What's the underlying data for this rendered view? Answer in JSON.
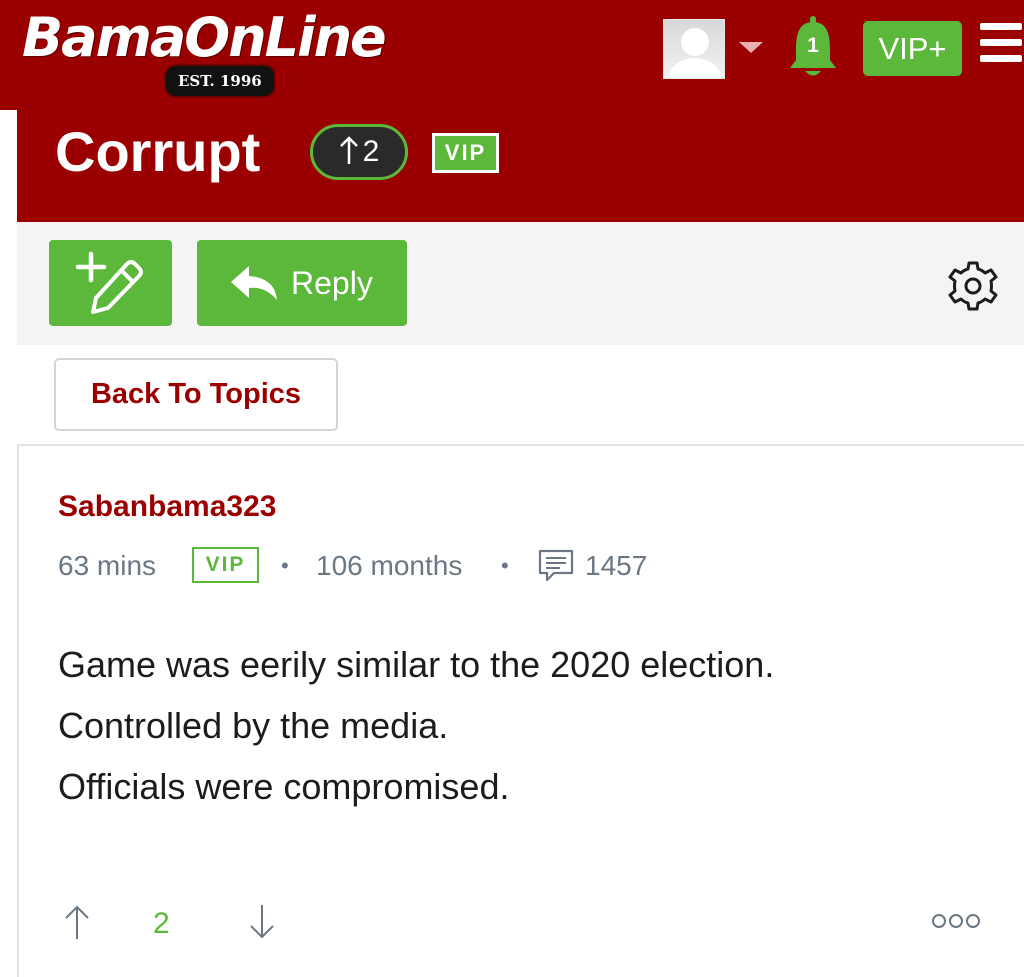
{
  "header": {
    "logo_text": "BamaOnLine",
    "logo_est": "EST. 1996",
    "notification_count": "1",
    "vip_plus_label": "VIP+"
  },
  "thread": {
    "title": "Corrupt",
    "vote_count": "2",
    "vip_badge": "VIP"
  },
  "toolbar": {
    "reply_label": "Reply"
  },
  "nav": {
    "back_label": "Back To Topics"
  },
  "post": {
    "author": "Sabanbama323",
    "time": "63 mins",
    "vip_badge": "VIP",
    "separator": "•",
    "member_for": "106 months",
    "post_count": "1457",
    "body": [
      "Game was eerily similar to the 2020 election.",
      "Controlled by the media.",
      "Officials were compromised."
    ],
    "votes": "2"
  },
  "icons": {
    "notification": "bell-icon",
    "menu": "hamburger-icon",
    "new_post": "compose-icon",
    "reply": "reply-icon",
    "settings": "gear-icon",
    "comments": "comment-icon",
    "upvote": "arrow-up-icon",
    "downvote": "arrow-down-icon",
    "more": "more-icon"
  },
  "colors": {
    "brand_red": "#9b0000",
    "accent_green": "#5cb83a",
    "meta_gray": "#6b7785"
  }
}
